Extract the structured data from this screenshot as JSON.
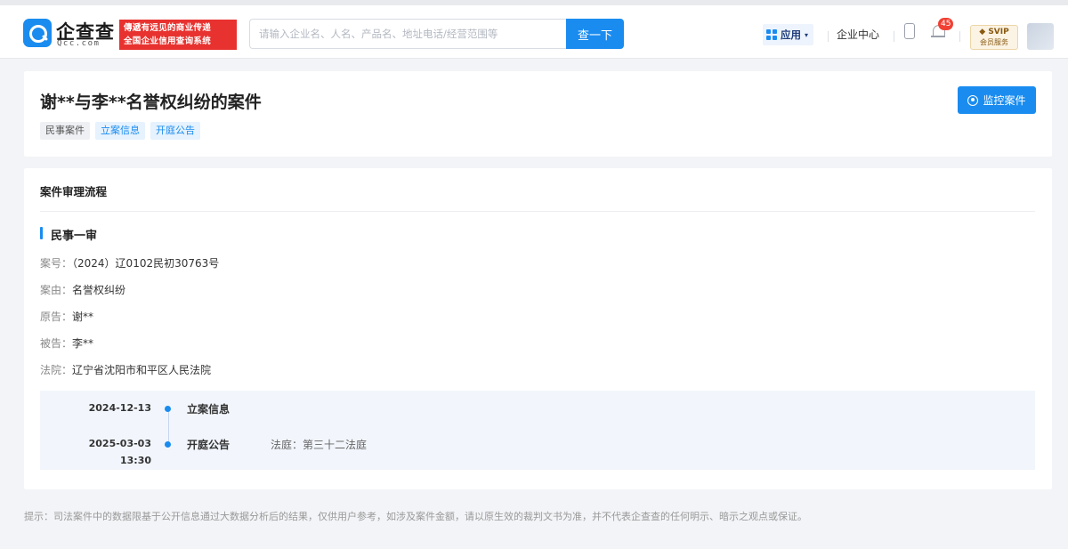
{
  "header": {
    "logo_cn": "企查查",
    "logo_en": "Qcc.com",
    "slogan_line1": "傳遞有远见的商业传递",
    "slogan_line2": "全国企业信用查询系统",
    "search_placeholder": "请输入企业名、人名、产品名、地址电话/经营范围等",
    "search_button": "查一下",
    "app_menu_label": "应用",
    "enterprise_center": "企业中心",
    "notification_count": "45",
    "svip_label": "SVIP",
    "svip_sub": "会员服务"
  },
  "case": {
    "title": "谢**与李**名誉权纠纷的案件",
    "tags": [
      "民事案件",
      "立案信息",
      "开庭公告"
    ],
    "monitor_button": "监控案件"
  },
  "process": {
    "section_title": "案件审理流程",
    "stage_title": "民事一审",
    "rows": [
      {
        "label": "案号：",
        "value": "（2024）辽0102民初30763号"
      },
      {
        "label": "案由：",
        "value": "名誉权纠纷"
      },
      {
        "label": "原告：",
        "value": "谢**"
      },
      {
        "label": "被告：",
        "value": "李**"
      },
      {
        "label": "法院：",
        "value": "辽宁省沈阳市和平区人民法院"
      }
    ],
    "timeline": [
      {
        "date": "2024-12-13",
        "time": "",
        "event": "立案信息",
        "detail": ""
      },
      {
        "date": "2025-03-03",
        "time": "13:30",
        "event": "开庭公告",
        "detail": "法庭：第三十二法庭"
      }
    ]
  },
  "footnote": "提示：司法案件中的数据限基于公开信息通过大数据分析后的结果，仅供用户参考，如涉及案件金额，请以原生效的裁判文书为准，并不代表企查查的任何明示、暗示之观点或保证。",
  "colors": {
    "accent": "#1a8cf0",
    "slogan_bg": "#e8322f",
    "badge": "#f04134"
  }
}
